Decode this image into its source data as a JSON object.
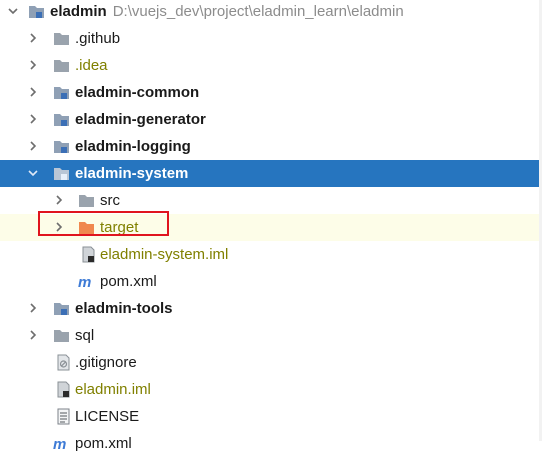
{
  "tree": {
    "root": {
      "name": "eladmin",
      "path": "D:\\vuejs_dev\\project\\eladmin_learn\\eladmin"
    },
    "items": [
      {
        "label": ".github",
        "type": "folder",
        "style": "normal"
      },
      {
        "label": ".idea",
        "type": "folder",
        "style": "olive"
      },
      {
        "label": "eladmin-common",
        "type": "module",
        "style": "bold"
      },
      {
        "label": "eladmin-generator",
        "type": "module",
        "style": "bold"
      },
      {
        "label": "eladmin-logging",
        "type": "module",
        "style": "bold"
      },
      {
        "label": "eladmin-system",
        "type": "module",
        "style": "bold-selected"
      },
      {
        "label": "src",
        "type": "folder",
        "style": "normal"
      },
      {
        "label": "target",
        "type": "folder-excluded",
        "style": "olive-highlight"
      },
      {
        "label": "eladmin-system.iml",
        "type": "iml-file",
        "style": "olive"
      },
      {
        "label": "pom.xml",
        "type": "maven-file",
        "style": "normal"
      },
      {
        "label": "eladmin-tools",
        "type": "module",
        "style": "bold"
      },
      {
        "label": "sql",
        "type": "folder",
        "style": "normal"
      },
      {
        "label": ".gitignore",
        "type": "file",
        "style": "normal"
      },
      {
        "label": "eladmin.iml",
        "type": "iml-file",
        "style": "olive"
      },
      {
        "label": "LICENSE",
        "type": "text-file",
        "style": "normal"
      },
      {
        "label": "pom.xml",
        "type": "maven-file",
        "style": "normal"
      }
    ]
  },
  "colors": {
    "selection": "#2675bf",
    "highlight_row": "#fdfde8",
    "excluded_folder": "#f0884f",
    "folder": "#9aa3ad",
    "module_folder": "#8fa0b5",
    "red_box": "#e0141e",
    "olive_text": "#808000"
  }
}
